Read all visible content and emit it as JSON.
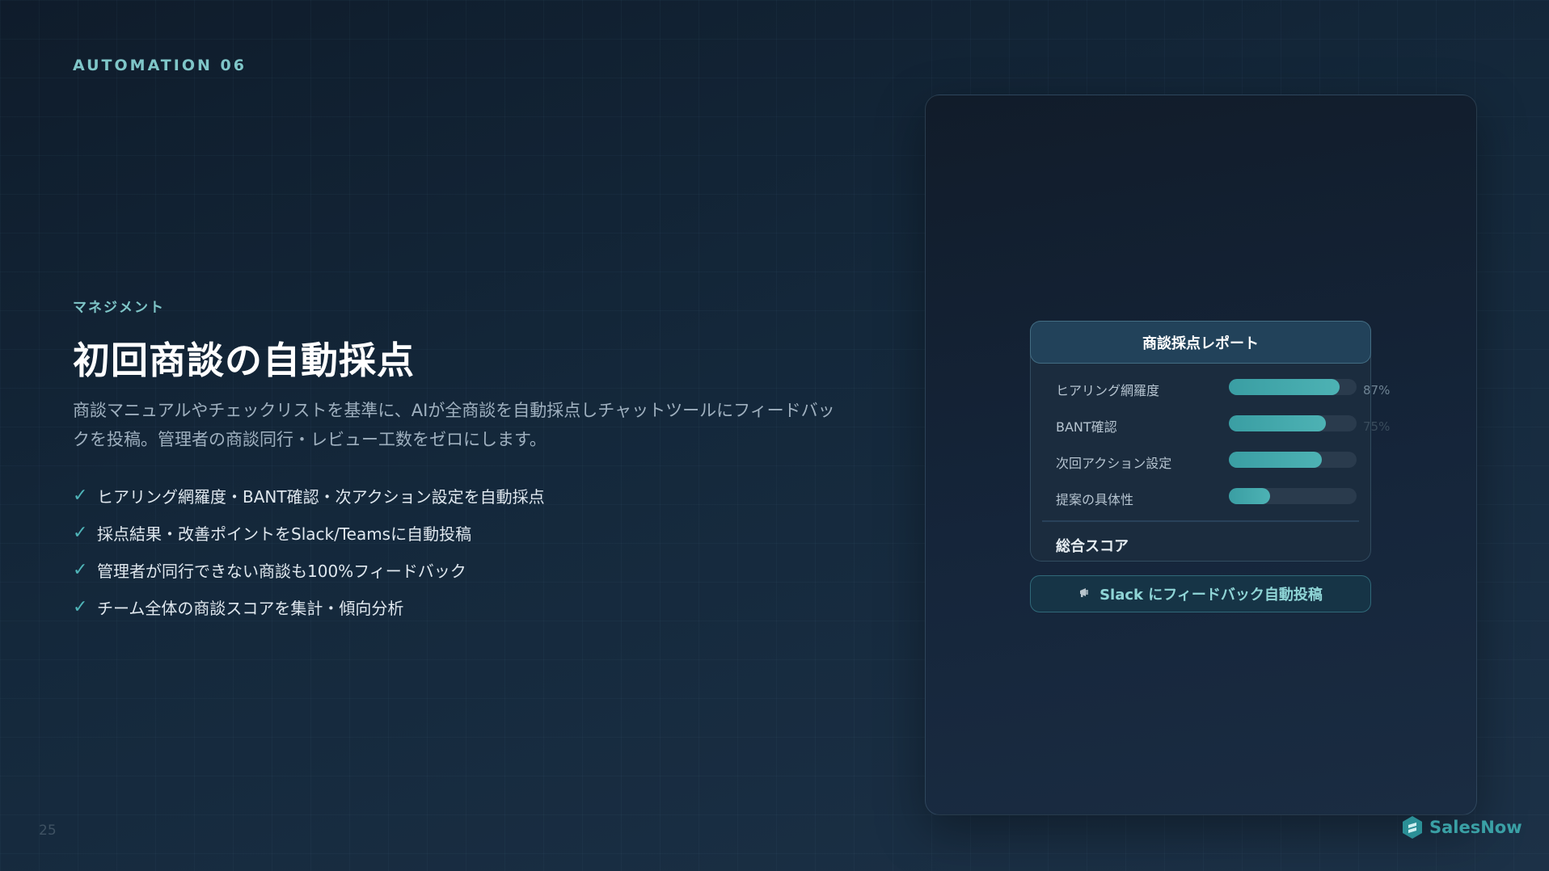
{
  "eyebrow": "AUTOMATION 06",
  "category": "マネジメント",
  "title": "初回商談の自動採点",
  "description": "商談マニュアルやチェックリストを基準に、AIが全商談を自動採点しチャットツールにフィードバックを投稿。管理者の商談同行・レビュー工数をゼロにします。",
  "features": [
    "ヒアリング網羅度・BANT確認・次アクション設定を自動採点",
    "採点結果・改善ポイントをSlack/Teamsに自動投稿",
    "管理者が同行できない商談も100%フィードバック",
    "チーム全体の商談スコアを集計・傾向分析"
  ],
  "check_glyph": "✓",
  "page_number": "25",
  "report": {
    "title": "商談採点レポート",
    "rows": [
      {
        "label": "ヒアリング網羅度",
        "value": 87,
        "pct_label": "87%"
      },
      {
        "label": "BANT確認",
        "value": 76,
        "pct_label": "75%"
      },
      {
        "label": "次回アクション設定",
        "value": 73,
        "pct_label": ""
      },
      {
        "label": "提案の具体性",
        "value": 32,
        "pct_label": ""
      }
    ],
    "total_label": "総合スコア"
  },
  "slack_button": {
    "icon": "megaphone-icon",
    "label": "Slack にフィードバック自動投稿"
  },
  "brand": {
    "name": "SalesNow",
    "accent": "#3aa0a5"
  }
}
